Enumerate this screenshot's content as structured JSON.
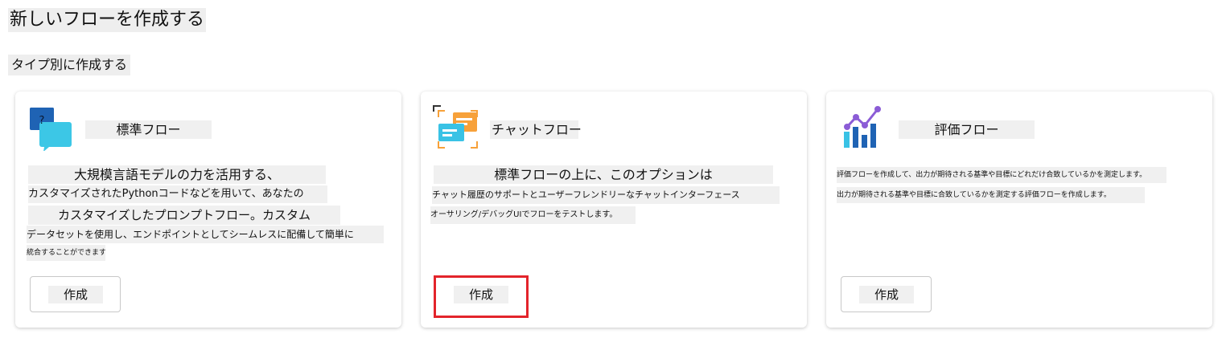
{
  "page": {
    "title": "新しいフローを作成する",
    "section_title": "タイプ別に作成する"
  },
  "cards": [
    {
      "title": "標準フロー",
      "icon": "chat-question-icon",
      "description_lines": [
        "大規模言語モデルの力を活用する、",
        "カスタマイズされたPythonコードなどを用いて、あなたの",
        "カスタマイズしたプロンプトフロー。カスタム",
        "データセットを使用し、エンドポイントとしてシームレスに配備して簡単に",
        "統合することができます。"
      ],
      "button_label": "作成"
    },
    {
      "title": "チャットフロー",
      "icon": "chat-window-icon",
      "description_lines": [
        "標準フローの上に、このオプションは",
        "チャット履歴のサポートとユーザーフレンドリーなチャットインターフェース",
        "オーサリング/デバッグUIでフローをテストします。"
      ],
      "button_label": "作成"
    },
    {
      "title": "評価フロー",
      "icon": "evaluation-chart-icon",
      "description_lines": [
        "評価フローを作成して、出力が期待される基準や目標にどれだけ合致しているかを測定します。",
        "出力が期待される基準や目標に合致しているかを測定する評価フローを作成します。"
      ],
      "button_label": "作成"
    }
  ],
  "colors": {
    "highlight": "#e3242b",
    "bar_blue": "#1f63b4",
    "accent_orange": "#f7a13a",
    "accent_cyan": "#39c2e5",
    "accent_purple": "#8b5cd6"
  }
}
